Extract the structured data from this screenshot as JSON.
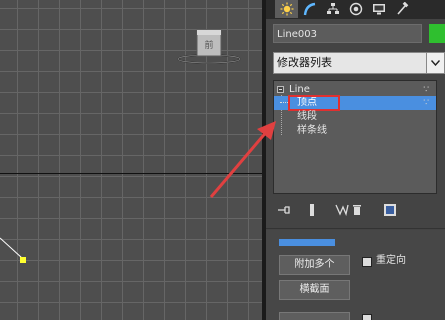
{
  "viewport": {
    "viewcube_icon": "viewcube-icon",
    "vertex_handle_color": "#ffff30"
  },
  "command_panel": {
    "tabs": [
      {
        "name": "create",
        "icon": "sun-icon"
      },
      {
        "name": "modify",
        "icon": "bend-icon"
      },
      {
        "name": "hierarchy",
        "icon": "hierarchy-icon"
      },
      {
        "name": "motion",
        "icon": "motion-icon"
      },
      {
        "name": "display",
        "icon": "monitor-icon"
      },
      {
        "name": "utilities",
        "icon": "hammer-icon"
      }
    ],
    "object_name": "Line003",
    "object_color": "#2fbf2f",
    "modifier_list": "修改器列表",
    "stack": {
      "root": "Line",
      "items": [
        "顶点",
        "线段",
        "样条线"
      ],
      "selected": "顶点"
    },
    "rollout": {
      "attach_multiple": "附加多个",
      "reorient": "重定向",
      "cross_section": "横截面"
    }
  },
  "colors": {
    "selection": "#4a8fe0",
    "highlight_box": "#e03030",
    "annotation_arrow": "#e04040"
  }
}
